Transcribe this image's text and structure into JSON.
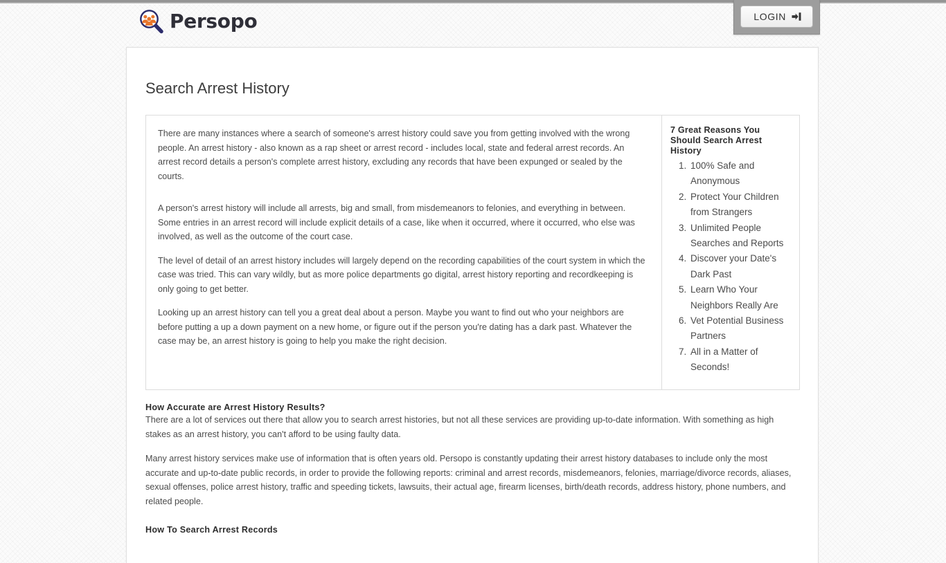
{
  "header": {
    "brand_name": "Persopo",
    "brand_icon": "magnifier-people-logo-icon",
    "login_label": "LOGIN",
    "login_icon": "sign-in-arrow-icon"
  },
  "page": {
    "title": "Search Arrest History"
  },
  "info_box": {
    "paragraphs": [
      "There are many instances where a search of someone's arrest history could save you from getting involved with the wrong people. An arrest history - also known as a rap sheet or arrest record - includes local, state and federal arrest records. An arrest record details a person's complete arrest history, excluding any records that have been expunged or sealed by the courts.",
      "A person's arrest history will include all arrests, big and small, from misdemeanors to felonies, and everything in between. Some entries in an arrest record will include explicit details of a case, like when it occurred, where it occurred, who else was involved, as well as the outcome of the court case.",
      "The level of detail of an arrest history includes will largely depend on the recording capabilities of the court system in which the case was tried. This can vary wildly, but as more police departments go digital, arrest history reporting and recordkeeping is only going to get better.",
      "Looking up an arrest history can tell you a great deal about a person. Maybe you want to find out who your neighbors are before putting a up a down payment on a new home, or figure out if the person you're dating has a dark past. Whatever the case may be, an arrest history is going to help you make the right decision."
    ],
    "sidebar": {
      "title": "7 Great Reasons You Should Search Arrest History",
      "items": [
        "100% Safe and Anonymous",
        "Protect Your Children from Strangers",
        "Unlimited People Searches and Reports",
        "Discover your Date's Dark Past",
        "Learn Who Your Neighbors Really Are",
        "Vet Potential Business Partners",
        "All in a Matter of Seconds!"
      ]
    }
  },
  "sections": [
    {
      "heading": "How Accurate are Arrest History Results?",
      "paragraphs": [
        "There are a lot of services out there that allow you to search arrest histories, but not all these services are providing up-to-date information. With something as high stakes as an arrest history, you can't afford to be using faulty data.",
        "Many arrest history services make use of information that is often years old. Persopo is constantly updating their arrest history databases to include only the most accurate and up-to-date public records, in order to provide the following reports: criminal and arrest records, misdemeanors, felonies, marriage/divorce records, aliases, sexual offenses, police arrest history, traffic and speeding tickets, lawsuits, their actual age, firearm licenses, birth/death records, address history, phone numbers, and related people."
      ]
    },
    {
      "heading": "How To Search Arrest Records",
      "paragraphs": []
    }
  ],
  "colors": {
    "brand_text": "#2f2f38",
    "logo_ring": "#2b2b6b",
    "logo_people": "#e8762c",
    "page_bg": "#fbfbfb",
    "card_bg": "#ffffff",
    "border": "#dcdcdc",
    "body_text": "#4b4b4b"
  }
}
